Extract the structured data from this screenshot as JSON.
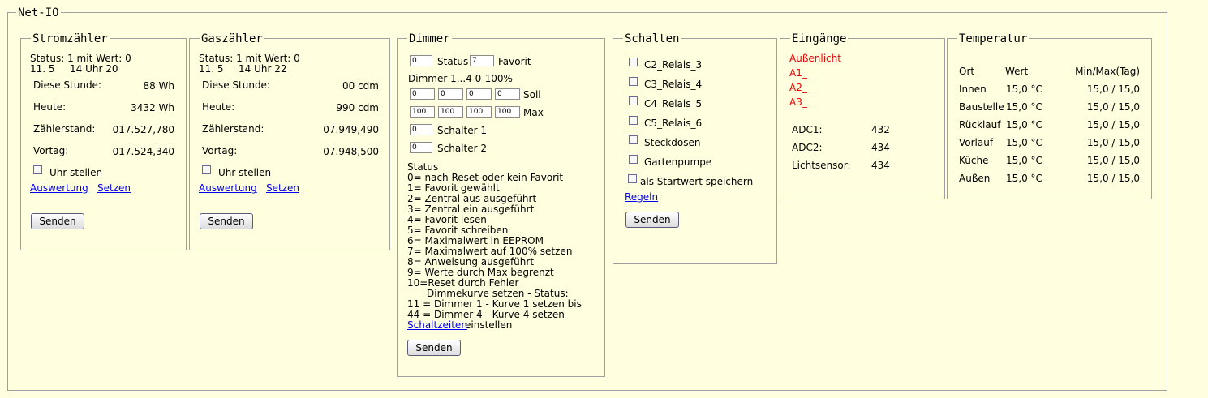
{
  "app": {
    "title": "Net-IO"
  },
  "strom": {
    "title": "Stromzähler",
    "status_line": "Status: 1 mit Wert: 0",
    "date": "11. 5",
    "time": "14 Uhr 20",
    "rows": [
      {
        "label": "Diese Stunde:",
        "value": "88 Wh"
      },
      {
        "label": "Heute:",
        "value": "3432 Wh"
      },
      {
        "label": "Zählerstand:",
        "value": "017.527,780"
      },
      {
        "label": "Vortag:",
        "value": "017.524,340"
      }
    ],
    "uhr_label": "Uhr stellen",
    "link_auswertung": "Auswertung",
    "link_setzen": "Setzen",
    "send": "Senden"
  },
  "gas": {
    "title": "Gaszähler",
    "status_line": "Status: 1 mit Wert: 0",
    "date": "11. 5",
    "time": "14 Uhr 22",
    "rows": [
      {
        "label": "Diese Stunde:",
        "value": "00 cdm"
      },
      {
        "label": "Heute:",
        "value": "990 cdm"
      },
      {
        "label": "Zählerstand:",
        "value": "07.949,490"
      },
      {
        "label": "Vortag:",
        "value": "07.948,500"
      }
    ],
    "uhr_label": "Uhr stellen",
    "link_auswertung": "Auswertung",
    "link_setzen": "Setzen",
    "send": "Senden"
  },
  "dimmer": {
    "title": "Dimmer",
    "status_value": "0",
    "status_label": "Status",
    "favorit_value": "7",
    "favorit_label": "Favorit",
    "range_label": "Dimmer 1...4 0-100%",
    "soll_values": [
      "0",
      "0",
      "0",
      "0"
    ],
    "soll_label": "Soll",
    "max_values": [
      "100",
      "100",
      "100",
      "100"
    ],
    "max_label": "Max",
    "schalter1_value": "0",
    "schalter1_label": "Schalter 1",
    "schalter2_value": "0",
    "schalter2_label": "Schalter 2",
    "status_help": [
      "Status",
      "0= nach Reset oder kein Favorit",
      "1= Favorit gewählt",
      "2= Zentral aus ausgeführt",
      "3= Zentral ein ausgeführt",
      "4= Favorit lesen",
      "5= Favorit schreiben",
      "6= Maximalwert in EEPROM",
      "7= Maximalwert auf 100% setzen",
      "8= Anweisung ausgeführt",
      "9= Werte durch Max begrenzt",
      "10=Reset durch Fehler",
      "Dimmekurve setzen - Status:",
      "11 = Dimmer 1 - Kurve 1 setzen bis",
      "44 = Dimmer 4 - Kurve 4 setzen"
    ],
    "schaltzeiten_link": "Schaltzeiten",
    "schaltzeiten_suffix": "einstellen",
    "send": "Senden"
  },
  "schalten": {
    "title": "Schalten",
    "items": [
      "C2_Relais_3",
      "C3_Relais_4",
      "C4_Relais_5",
      "C5_Relais_6",
      "Steckdosen",
      "Gartenpumpe"
    ],
    "startwert_label": "als Startwert speichern",
    "regeln_link": "Regeln",
    "send": "Senden"
  },
  "eingaenge": {
    "title": "Eingänge",
    "inputs": [
      "Außenlicht",
      "A1_",
      "A2_",
      "A3_"
    ],
    "adc": [
      {
        "label": "ADC1:",
        "value": "432"
      },
      {
        "label": "ADC2:",
        "value": "434"
      },
      {
        "label": "Lichtsensor:",
        "value": "434"
      }
    ],
    "input_color": "#ee0000"
  },
  "temperatur": {
    "title": "Temperatur",
    "headers": {
      "ort": "Ort",
      "wert": "Wert",
      "minmax": "Min/Max(Tag)"
    },
    "rows": [
      {
        "ort": "Innen",
        "wert": "15,0 °C",
        "minmax": "15,0 / 15,0"
      },
      {
        "ort": "Baustelle",
        "wert": "15,0 °C",
        "minmax": "15,0 / 15,0"
      },
      {
        "ort": "Rücklauf",
        "wert": "15,0 °C",
        "minmax": "15,0 / 15,0"
      },
      {
        "ort": "Vorlauf",
        "wert": "15,0 °C",
        "minmax": "15,0 / 15,0"
      },
      {
        "ort": "Küche",
        "wert": "15,0 °C",
        "minmax": "15,0 / 15,0"
      },
      {
        "ort": "Außen",
        "wert": "15,0 °C",
        "minmax": "15,0 / 15,0"
      }
    ]
  }
}
